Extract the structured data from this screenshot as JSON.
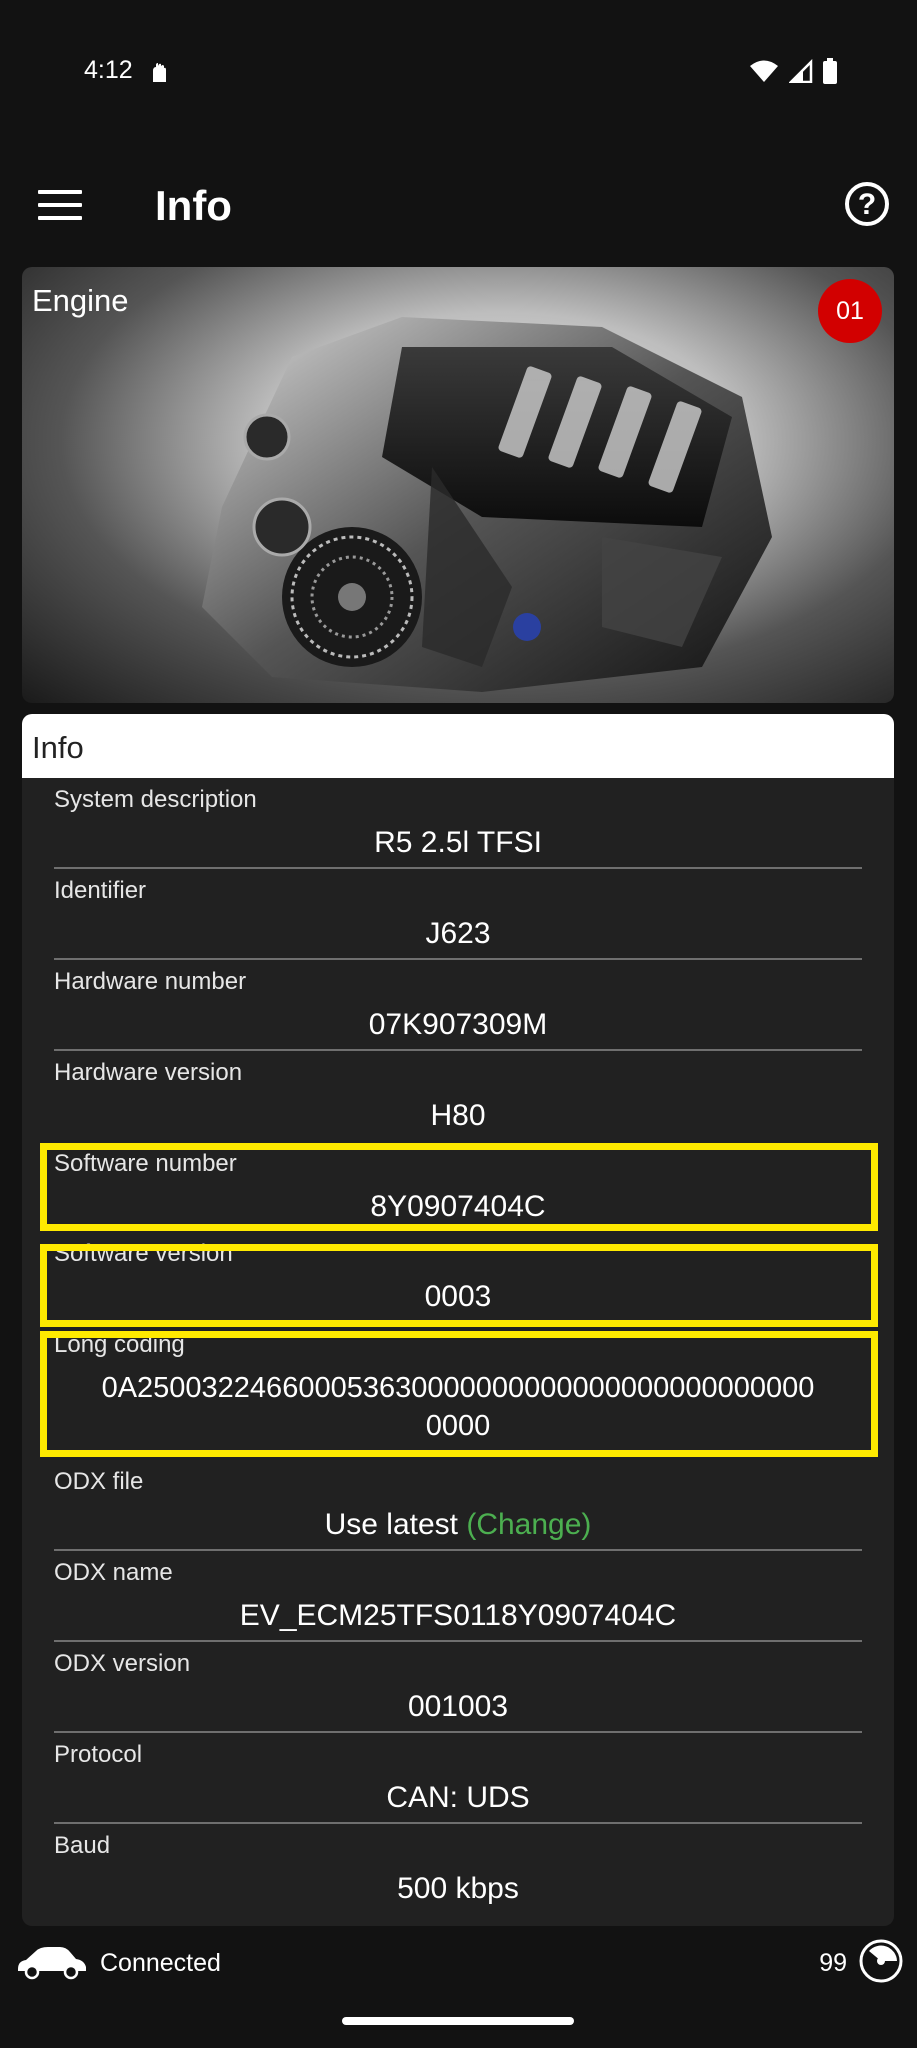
{
  "status_bar": {
    "time": "4:12"
  },
  "app_bar": {
    "title": "Info"
  },
  "engine_card": {
    "label": "Engine",
    "badge": "01"
  },
  "info_section": {
    "header": "Info",
    "rows": [
      {
        "label": "System description",
        "value": "R5 2.5l TFSI"
      },
      {
        "label": "Identifier",
        "value": "J623"
      },
      {
        "label": "Hardware number",
        "value": "07K907309M"
      },
      {
        "label": "Hardware version",
        "value": "H80"
      },
      {
        "label": "Software number",
        "value": "8Y0907404C"
      },
      {
        "label": "Software version",
        "value": "0003"
      },
      {
        "label": "Long coding",
        "value": "0A250032246600053630000000000000000000000000",
        "value_line2": "0000"
      },
      {
        "label": "ODX file",
        "value": "Use latest",
        "link": "(Change)"
      },
      {
        "label": "ODX name",
        "value": "EV_ECM25TFS0118Y0907404C"
      },
      {
        "label": "ODX version",
        "value": "001003"
      },
      {
        "label": "Protocol",
        "value": "CAN: UDS"
      },
      {
        "label": "Baud",
        "value": "500 kbps"
      }
    ]
  },
  "bottom_bar": {
    "status": "Connected",
    "count": "99"
  },
  "colors": {
    "highlight": "#ffea00",
    "badge": "#d20000",
    "link": "#4caf50",
    "background": "#121212",
    "panel": "#212121"
  }
}
